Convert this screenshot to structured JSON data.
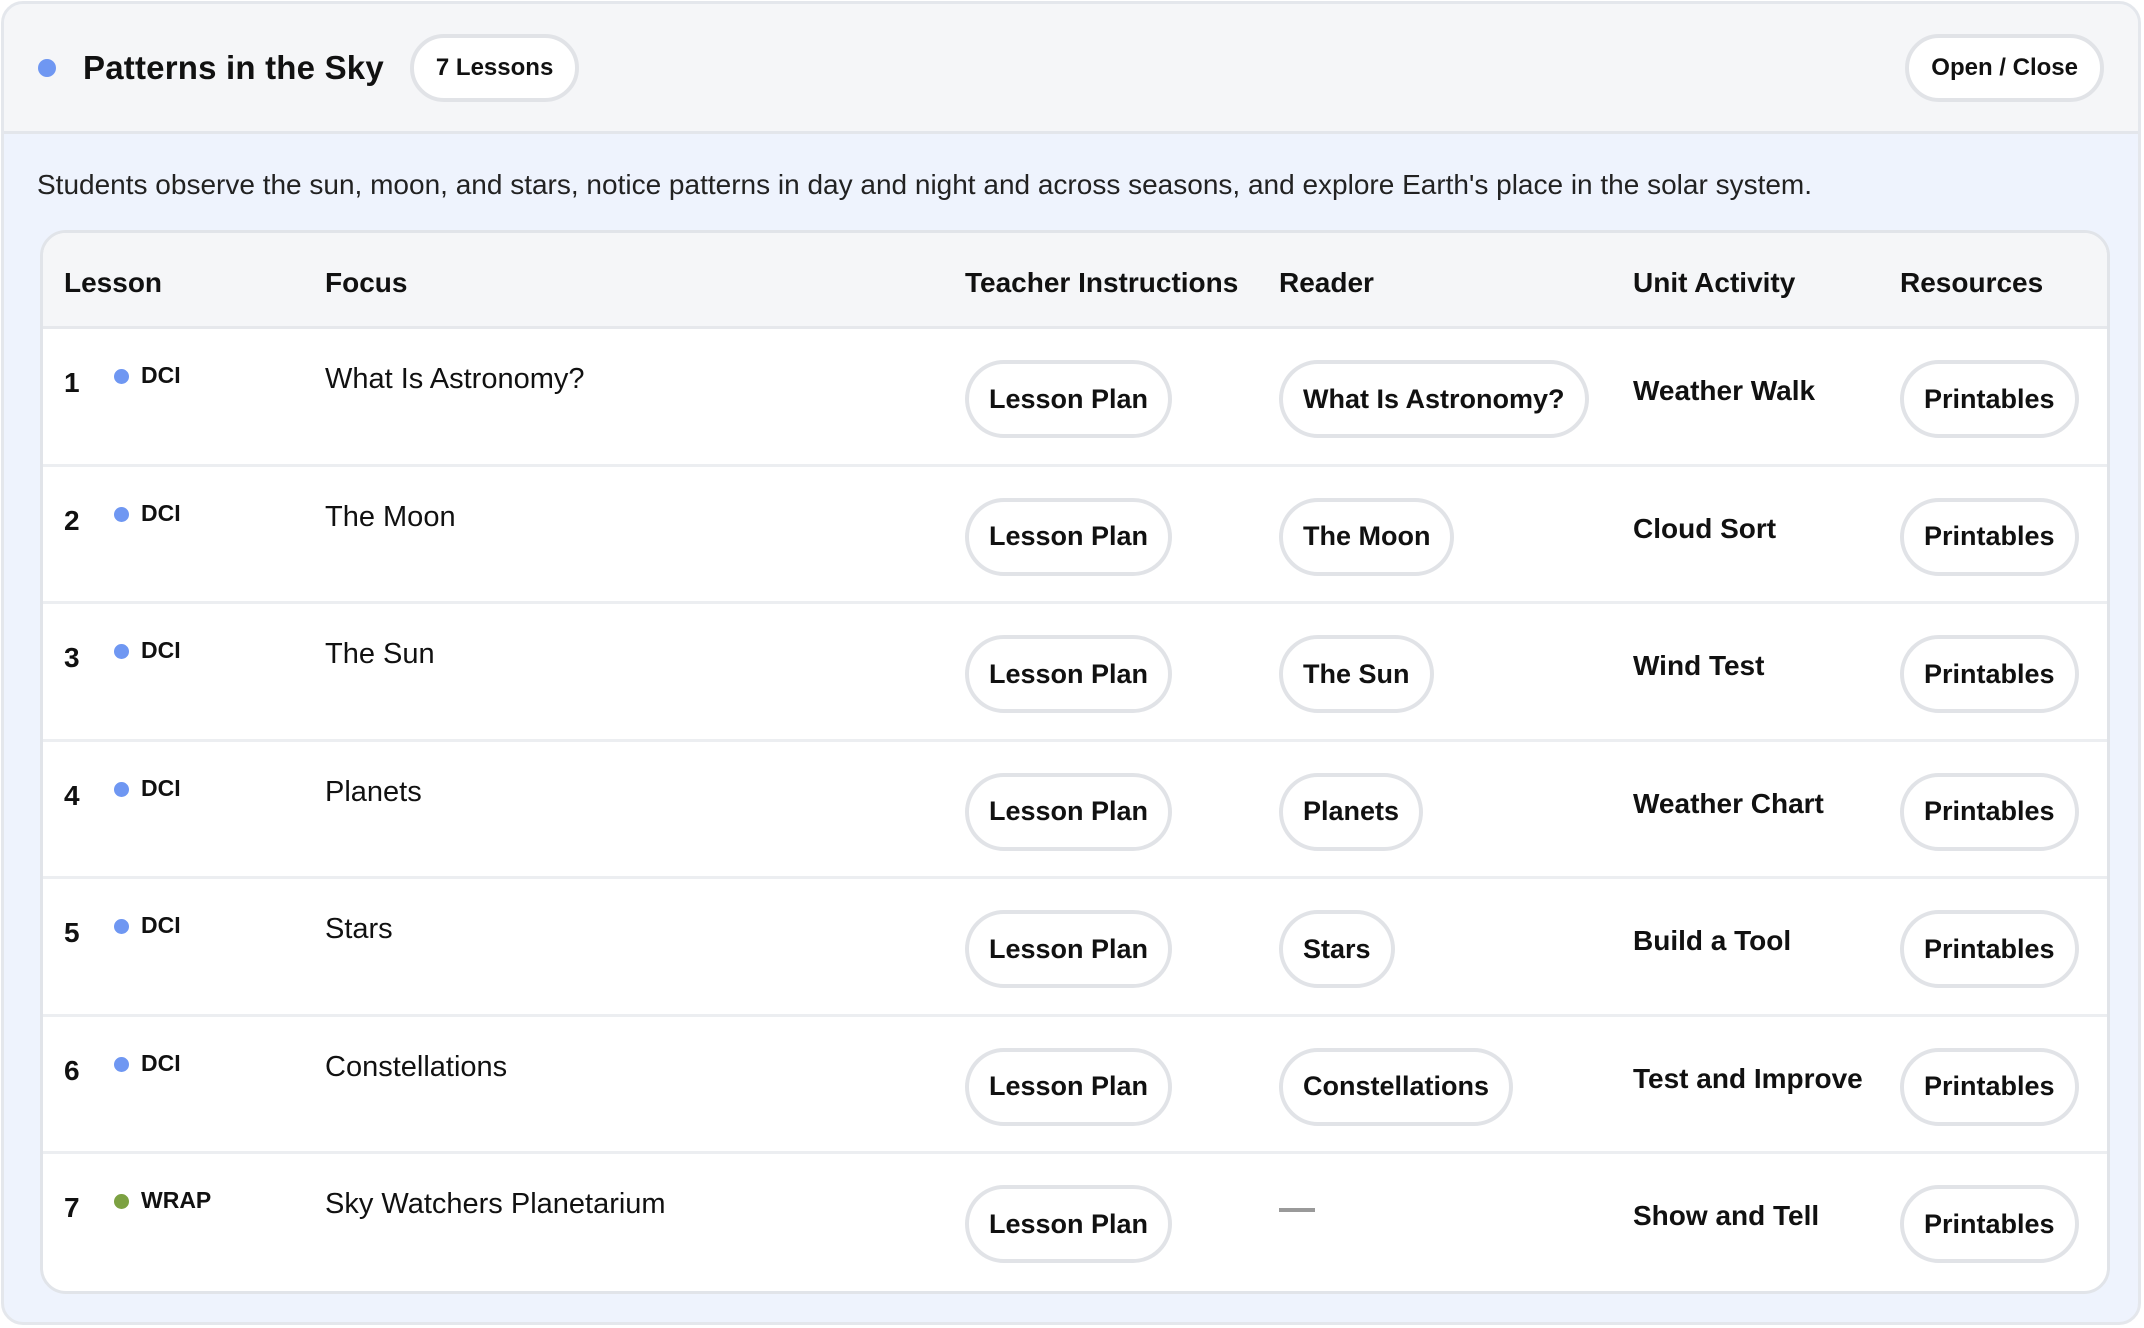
{
  "unit": {
    "title": "Patterns in the Sky",
    "lesson_count": "7 Lessons",
    "toggle_label": "Open / Close",
    "description": "Students observe the sun, moon, and stars, notice patterns in day and night and across seasons, and explore Earth's place in the solar system."
  },
  "table": {
    "headers": {
      "lesson": "Lesson",
      "focus": "Focus",
      "teacher": "Teacher Instructions",
      "reader": "Reader",
      "activity": "Unit Activity",
      "resources": "Resources"
    },
    "rows": [
      {
        "num": "1",
        "type": "DCI",
        "focus": "What Is Astronomy?",
        "plan": "Lesson Plan",
        "reader": "What Is Astronomy?",
        "activity": "Weather Walk",
        "resources": "Printables"
      },
      {
        "num": "2",
        "type": "DCI",
        "focus": "The Moon",
        "plan": "Lesson Plan",
        "reader": "The Moon",
        "activity": "Cloud Sort",
        "resources": "Printables"
      },
      {
        "num": "3",
        "type": "DCI",
        "focus": "The Sun",
        "plan": "Lesson Plan",
        "reader": "The Sun",
        "activity": "Wind Test",
        "resources": "Printables"
      },
      {
        "num": "4",
        "type": "DCI",
        "focus": "Planets",
        "plan": "Lesson Plan",
        "reader": "Planets",
        "activity": "Weather Chart",
        "resources": "Printables"
      },
      {
        "num": "5",
        "type": "DCI",
        "focus": "Stars",
        "plan": "Lesson Plan",
        "reader": "Stars",
        "activity": "Build a Tool",
        "resources": "Printables"
      },
      {
        "num": "6",
        "type": "DCI",
        "focus": "Constellations",
        "plan": "Lesson Plan",
        "reader": "Constellations",
        "activity": "Test and Improve",
        "resources": "Printables"
      },
      {
        "num": "7",
        "type": "WRAP",
        "focus": "Sky Watchers Planetarium",
        "plan": "Lesson Plan",
        "reader": "",
        "activity": "Show and Tell",
        "resources": "Printables"
      }
    ]
  },
  "colors": {
    "unit_dot": "#6f97f2",
    "dci_dot": "#6f97f2",
    "wrap_dot": "#7ca142"
  }
}
